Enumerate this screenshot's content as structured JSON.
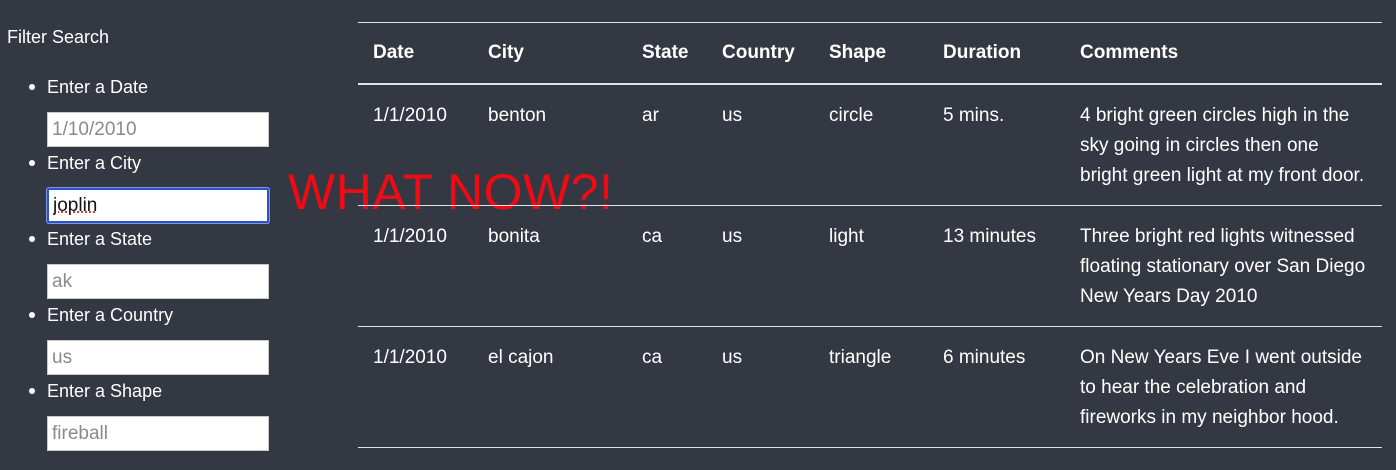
{
  "sidebar": {
    "title": "Filter Search",
    "filters": [
      {
        "label": "Enter a Date",
        "placeholder": "1/10/2010",
        "value": ""
      },
      {
        "label": "Enter a City",
        "placeholder": "",
        "value": "joplin"
      },
      {
        "label": "Enter a State",
        "placeholder": "ak",
        "value": ""
      },
      {
        "label": "Enter a Country",
        "placeholder": "us",
        "value": ""
      },
      {
        "label": "Enter a Shape",
        "placeholder": "fireball",
        "value": ""
      }
    ]
  },
  "overlay": {
    "text": "WHAT NOW?!",
    "color": "#ee0b14"
  },
  "table": {
    "headers": [
      "Date",
      "City",
      "State",
      "Country",
      "Shape",
      "Duration",
      "Comments"
    ],
    "rows": [
      [
        "1/1/2010",
        "benton",
        "ar",
        "us",
        "circle",
        "5 mins.",
        "4 bright green circles high in the sky going in circles then one bright green light at my front door."
      ],
      [
        "1/1/2010",
        "bonita",
        "ca",
        "us",
        "light",
        "13 minutes",
        "Three bright red lights witnessed floating stationary over San Diego New Years Day 2010"
      ],
      [
        "1/1/2010",
        "el cajon",
        "ca",
        "us",
        "triangle",
        "6 minutes",
        "On New Years Eve I went outside to hear the celebration and fireworks in my neighbor hood."
      ]
    ]
  },
  "colors": {
    "background": "#333842",
    "focus_border": "#2b53c7"
  }
}
